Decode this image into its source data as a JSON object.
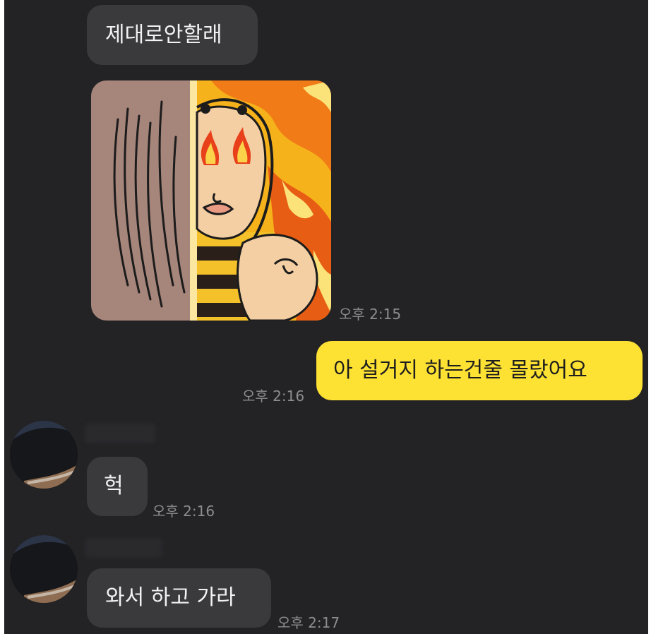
{
  "messages": [
    {
      "text": "제대로안할래",
      "sender": "other"
    },
    {
      "type": "sticker",
      "sticker_icon": "angry-flaming-eyes-character-sticker",
      "time": "오후 2:15",
      "sender": "other"
    },
    {
      "text": "아 설거지 하는건줄 몰랐어요",
      "time": "오후 2:16",
      "sender": "me"
    },
    {
      "text": "헉",
      "time": "오후 2:16",
      "sender": "other"
    },
    {
      "text": "와서 하고 가라",
      "time": "오후 2:17",
      "sender": "other"
    }
  ],
  "colors": {
    "background": "#232325",
    "received_bubble": "#3a3a3d",
    "sent_bubble": "#fde133",
    "time_text": "#8d8d90"
  }
}
